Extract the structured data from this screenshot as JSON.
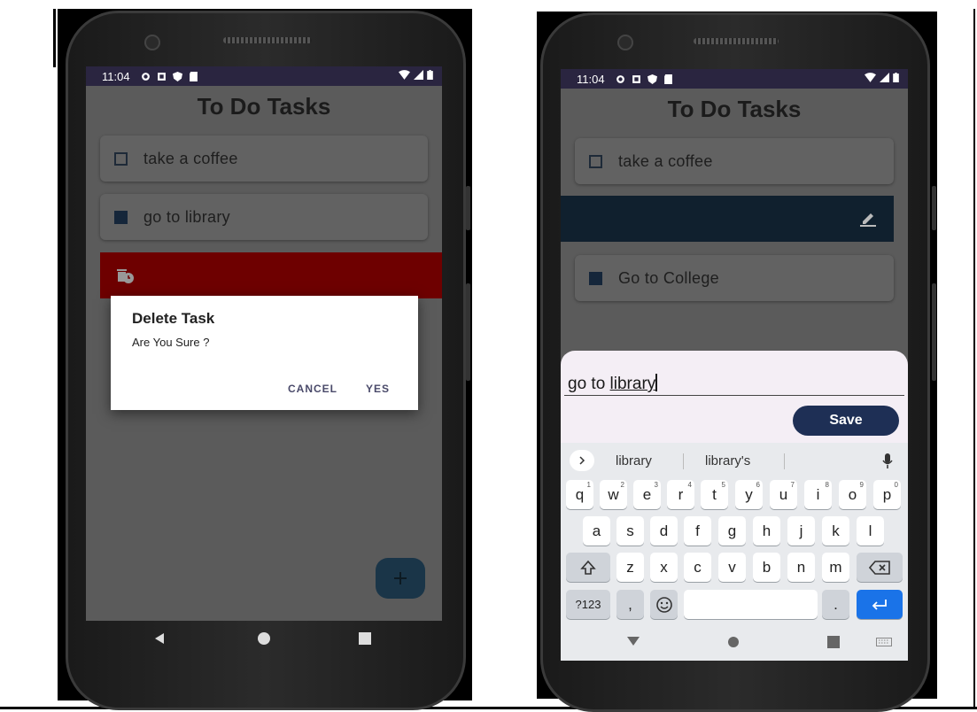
{
  "left_phone": {
    "status": {
      "time": "11:04"
    },
    "app_title": "To Do Tasks",
    "tasks": [
      {
        "text": "take a coffee",
        "checked": false
      },
      {
        "text": "go to library",
        "checked": true
      }
    ],
    "swipe_action": "delete-clock-icon",
    "dialog": {
      "title": "Delete Task",
      "message": "Are You Sure ?",
      "cancel_label": "CANCEL",
      "yes_label": "YES"
    },
    "fab_icon": "plus-icon"
  },
  "right_phone": {
    "status": {
      "time": "11:04"
    },
    "app_title": "To Do Tasks",
    "tasks": [
      {
        "text": "take a coffee",
        "checked": false
      },
      {
        "text": "Go to College",
        "checked": true
      }
    ],
    "swipe_action": "edit-pencil-icon",
    "edit": {
      "value_plain": "go to ",
      "value_underlined": "library",
      "save_label": "Save"
    },
    "keyboard": {
      "suggestions": [
        "library",
        "library's"
      ],
      "row1": [
        "q",
        "w",
        "e",
        "r",
        "t",
        "y",
        "u",
        "i",
        "o",
        "p"
      ],
      "row1_hints": [
        "1",
        "2",
        "3",
        "4",
        "5",
        "6",
        "7",
        "8",
        "9",
        "0"
      ],
      "row2": [
        "a",
        "s",
        "d",
        "f",
        "g",
        "h",
        "j",
        "k",
        "l"
      ],
      "row3": [
        "z",
        "x",
        "c",
        "v",
        "b",
        "n",
        "m"
      ],
      "symbols_label": "?123",
      "comma": ",",
      "period": "."
    }
  },
  "colors": {
    "accent_red": "#6e0000",
    "accent_navy": "#10202e",
    "save_button": "#1e2f55",
    "status_bar": "#2a2540"
  }
}
